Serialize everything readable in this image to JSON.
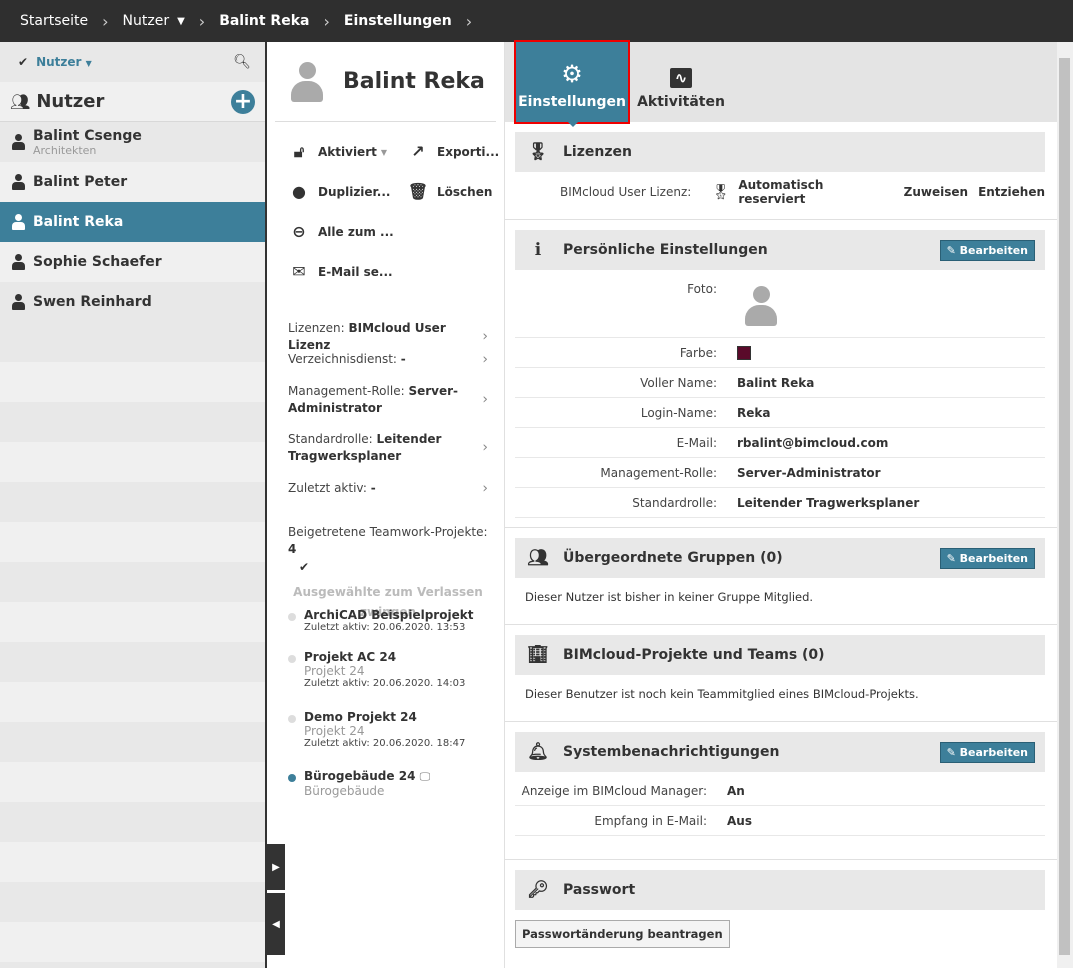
{
  "breadcrumb": [
    "Startseite",
    "Nutzer",
    "Balint Reka",
    "Einstellungen"
  ],
  "sidebar": {
    "filter_label": "Nutzer",
    "title": "Nutzer",
    "users": [
      {
        "name": "Balint Csenge",
        "sub": "Architekten"
      },
      {
        "name": "Balint Peter",
        "sub": ""
      },
      {
        "name": "Balint Reka",
        "sub": "",
        "selected": true
      },
      {
        "name": "Sophie Schaefer",
        "sub": ""
      },
      {
        "name": "Swen Reinhard",
        "sub": ""
      }
    ]
  },
  "user": {
    "name": "Balint Reka",
    "actions": {
      "activated": "Aktiviert",
      "export": "Exporti...",
      "duplicate": "Duplizier...",
      "delete": "Löschen",
      "all_leave": "Alle zum ...",
      "email": "E-Mail se..."
    },
    "info": [
      {
        "label": "Lizenzen: ",
        "value": "BIMcloud User Lizenz"
      },
      {
        "label": "Verzeichnisdienst: ",
        "value": "-"
      },
      {
        "label": "Management-Rolle: ",
        "value": "Server-Administrator"
      },
      {
        "label": "Standardrolle: ",
        "value": "Leitender Tragwerksplaner"
      },
      {
        "label": "Zuletzt aktiv: ",
        "value": "-"
      }
    ],
    "joined_label": "Beigetretene Teamwork-Projekte: ",
    "joined_count": "4",
    "force_leave": "Ausgewählte zum Verlassen zwingen",
    "projects": [
      {
        "name": "ArchiCAD Beispielprojekt",
        "sub": "",
        "date": "Zuletzt aktiv: 20.06.2020. 13:53"
      },
      {
        "name": "Projekt AC 24",
        "sub": "Projekt 24",
        "date": "Zuletzt aktiv: 20.06.2020. 14:03"
      },
      {
        "name": "Demo Projekt 24",
        "sub": "Projekt 24",
        "date": "Zuletzt aktiv: 20.06.2020. 18:47"
      },
      {
        "name": "Bürogebäude 24",
        "sub": "Bürogebäude",
        "date": ""
      }
    ]
  },
  "tabs": {
    "settings": "Einstellungen",
    "activities": "Aktivitäten"
  },
  "licenses": {
    "title": "Lizenzen",
    "label": "BIMcloud User Lizenz:",
    "value": "Automatisch reserviert",
    "assign": "Zuweisen",
    "revoke": "Entziehen"
  },
  "personal": {
    "title": "Persönliche Einstellungen",
    "edit": "Bearbeiten",
    "photo_label": "Foto:",
    "color_label": "Farbe:",
    "color": "#5a0a2a",
    "fields": [
      {
        "k": "Voller Name:",
        "v": "Balint Reka"
      },
      {
        "k": "Login-Name:",
        "v": "Reka"
      },
      {
        "k": "E-Mail:",
        "v": "rbalint@bimcloud.com"
      },
      {
        "k": "Management-Rolle:",
        "v": "Server-Administrator"
      },
      {
        "k": "Standardrolle:",
        "v": "Leitender Tragwerksplaner"
      }
    ]
  },
  "groups": {
    "title": "Übergeordnete Gruppen (0)",
    "edit": "Bearbeiten",
    "text": "Dieser Nutzer ist bisher in keiner Gruppe Mitglied."
  },
  "projects_teams": {
    "title": "BIMcloud-Projekte und Teams (0)",
    "text": "Dieser Benutzer ist noch kein Teammitglied eines BIMcloud-Projekts."
  },
  "notifications": {
    "title": "Systembenachrichtigungen",
    "edit": "Bearbeiten",
    "fields": [
      {
        "k": "Anzeige im BIMcloud Manager:",
        "v": "An"
      },
      {
        "k": "Empfang in E-Mail:",
        "v": "Aus"
      }
    ]
  },
  "password": {
    "title": "Passwort",
    "button": "Passwortänderung beantragen"
  },
  "accent": "#3d7f9a"
}
